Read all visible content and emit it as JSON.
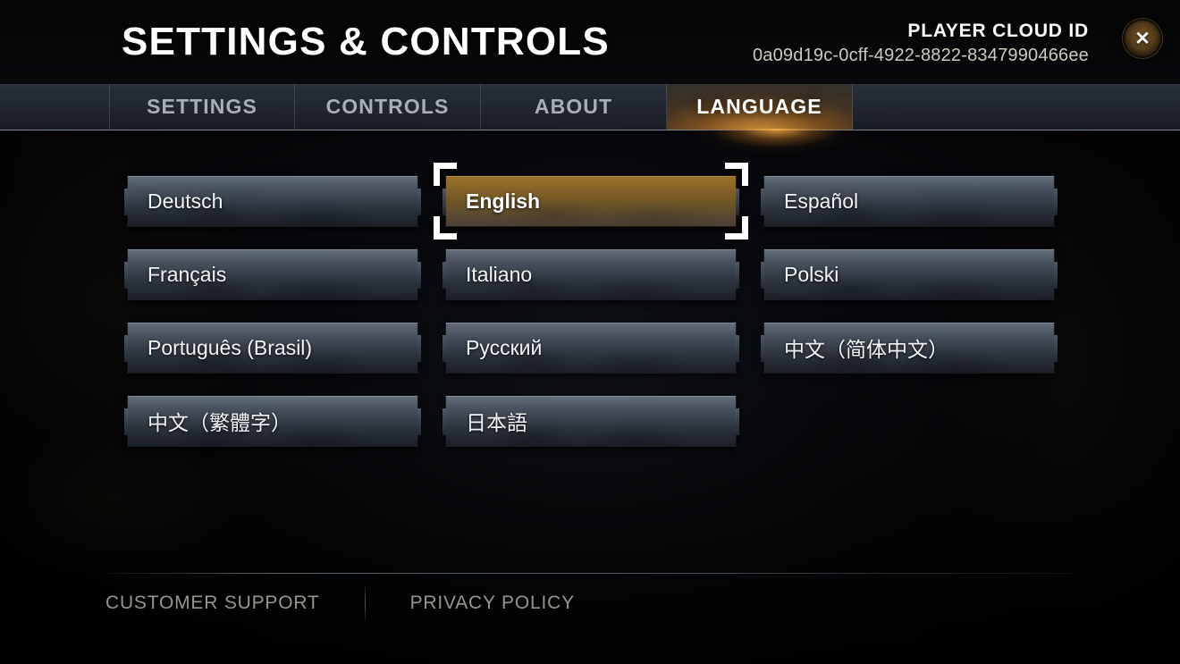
{
  "header": {
    "title": "SETTINGS & CONTROLS",
    "cloud_id_label": "PLAYER CLOUD ID",
    "cloud_id_value": "0a09d19c-0cff-4922-8822-8347990466ee",
    "close_label": "X"
  },
  "tabs": [
    {
      "label": "SETTINGS",
      "active": false
    },
    {
      "label": "CONTROLS",
      "active": false
    },
    {
      "label": "ABOUT",
      "active": false
    },
    {
      "label": "LANGUAGE",
      "active": true
    }
  ],
  "languages": [
    {
      "label": "Deutsch",
      "selected": false
    },
    {
      "label": "English",
      "selected": true
    },
    {
      "label": "Español",
      "selected": false
    },
    {
      "label": "Français",
      "selected": false
    },
    {
      "label": "Italiano",
      "selected": false
    },
    {
      "label": "Polski",
      "selected": false
    },
    {
      "label": "Português (Brasil)",
      "selected": false
    },
    {
      "label": "Русский",
      "selected": false
    },
    {
      "label": "中文（简体中文）",
      "selected": false
    },
    {
      "label": "中文（繁體字）",
      "selected": false
    },
    {
      "label": "日本語",
      "selected": false
    }
  ],
  "footer": {
    "customer_support": "CUSTOMER SUPPORT",
    "privacy_policy": "PRIVACY POLICY"
  },
  "colors": {
    "accent_amber": "#ffb240",
    "selected_gold": "#8a6526",
    "button_slate": "#6c7886",
    "text_primary": "#ffffff",
    "text_muted": "#a7aeb7",
    "footer_text": "#9a958c"
  }
}
